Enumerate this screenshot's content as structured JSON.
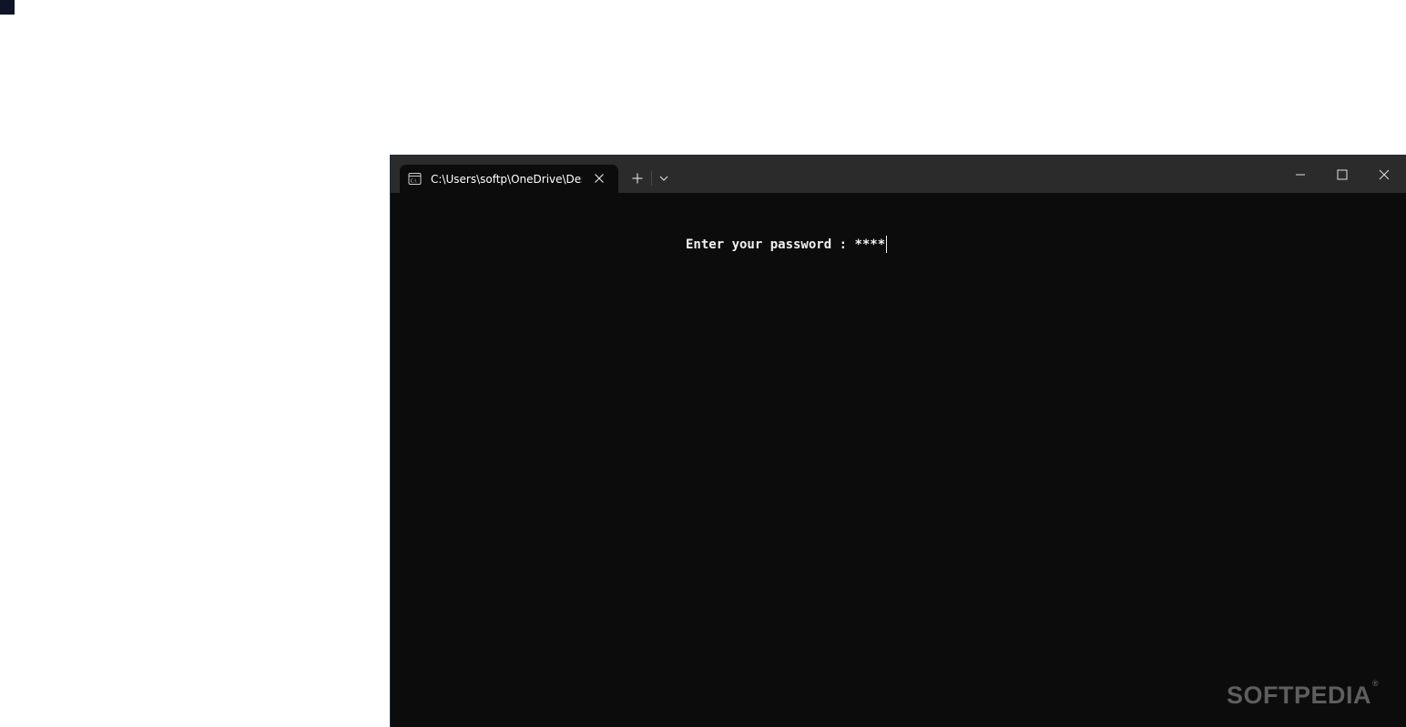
{
  "tab": {
    "title": "C:\\Users\\softp\\OneDrive\\Desktop\\PasswordMasking.exe",
    "icon": "console-icon"
  },
  "console": {
    "prompt": "Enter your password : ",
    "masked_input": "****"
  },
  "watermark": {
    "text": "SOFTPEDIA",
    "mark": "®"
  },
  "colors": {
    "titlebar": "#2b2b2b",
    "console_background": "#0c0c0c",
    "console_text": "#f2f2f2"
  }
}
